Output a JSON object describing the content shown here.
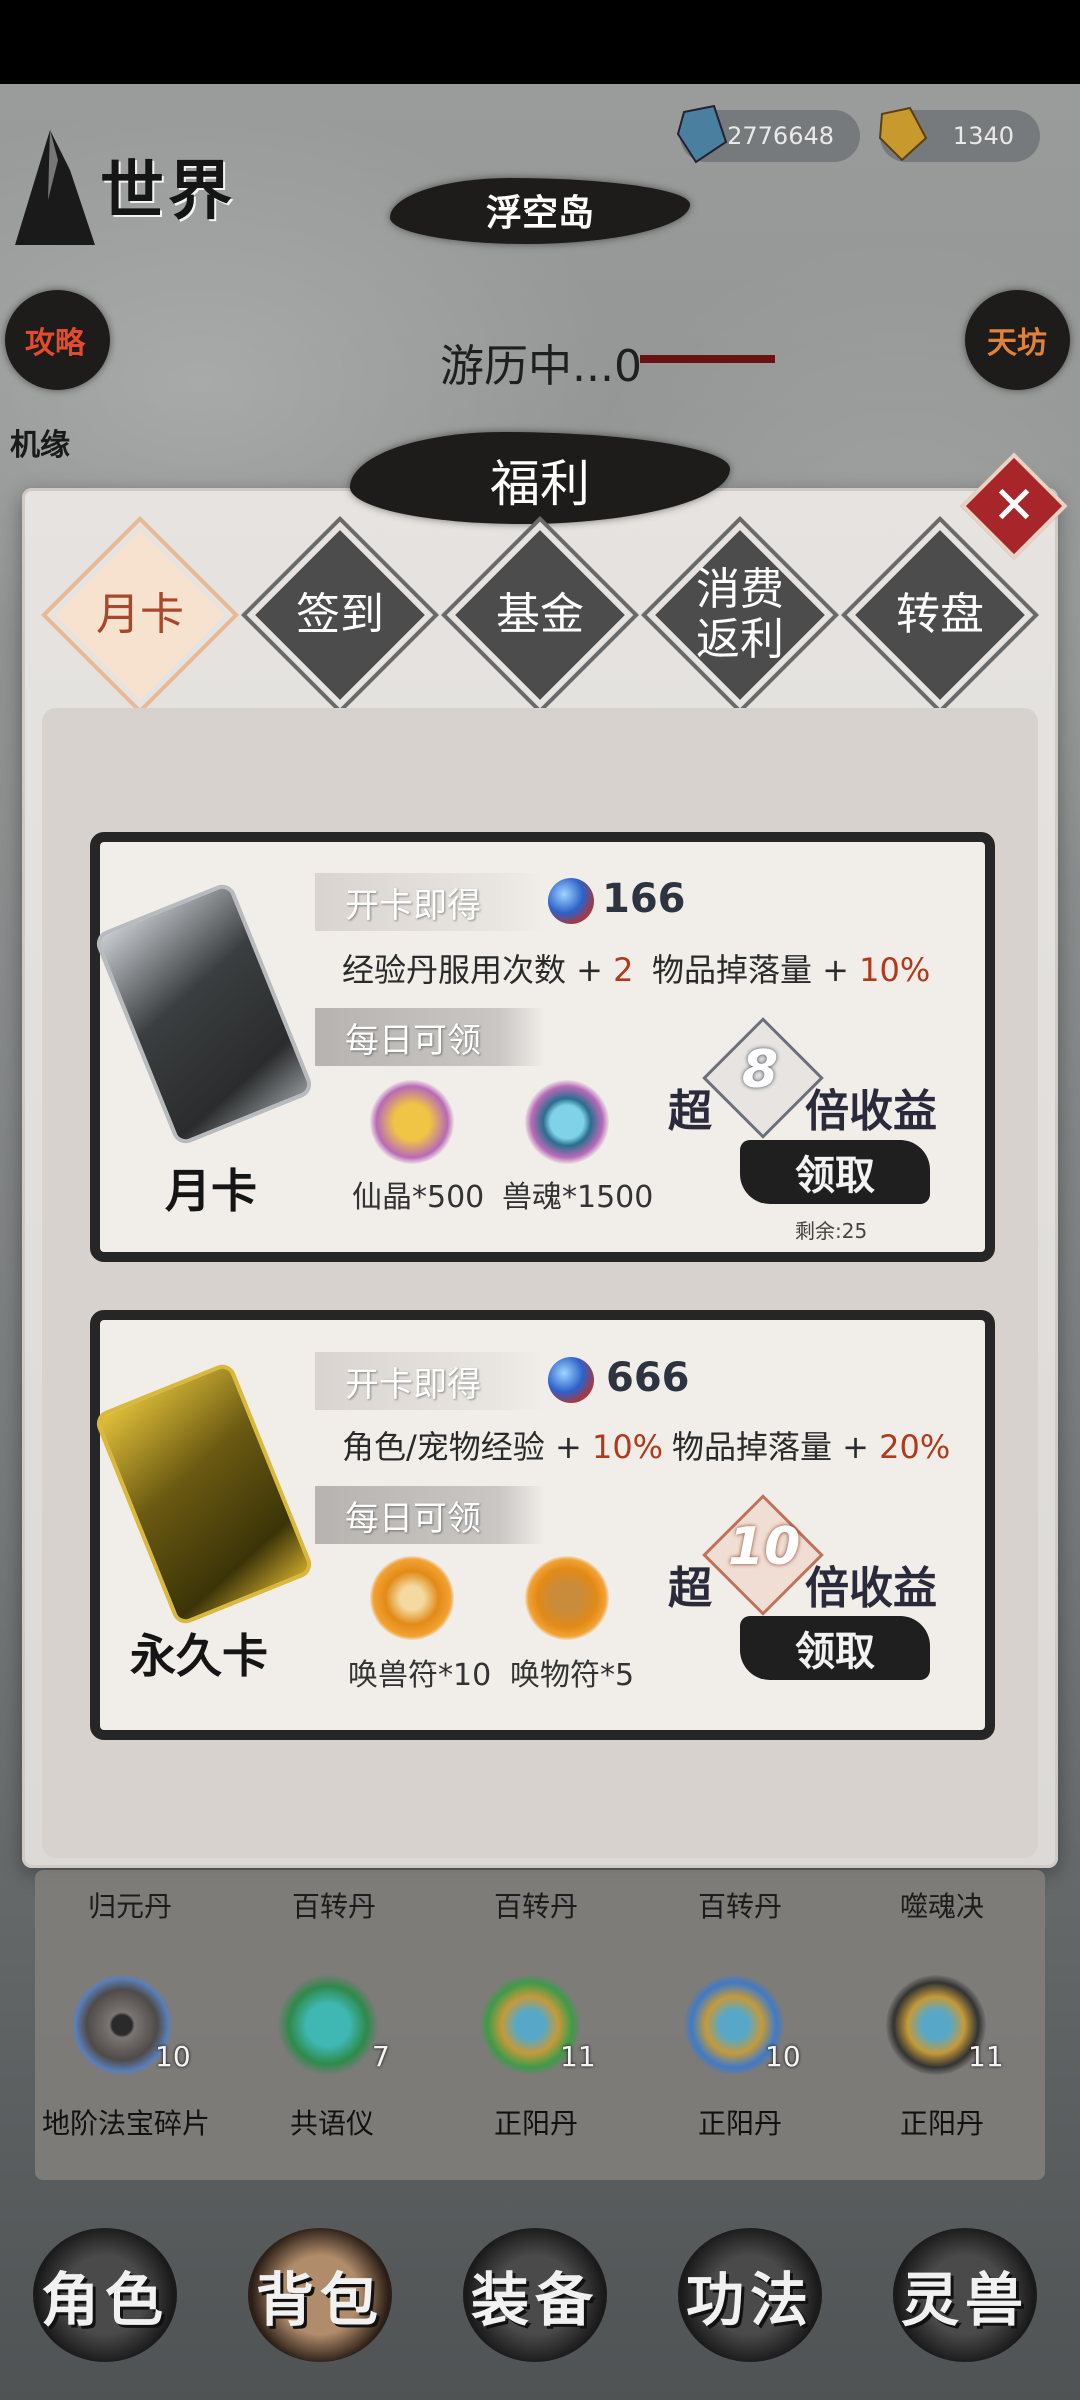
{
  "world": {
    "title": "世界",
    "location": "浮空岛",
    "travel_status": "游历中...0"
  },
  "currencies": [
    {
      "name": "spirit-crystal",
      "value": "2776648",
      "color": "#4a7fa0"
    },
    {
      "name": "gold-ingot",
      "value": "1340",
      "color": "#c89a2e"
    }
  ],
  "side_buttons": {
    "guide": "攻略",
    "chance": "机缘",
    "market": "天坊"
  },
  "panel": {
    "title": "福利",
    "tabs": [
      {
        "label": "月卡",
        "active": true
      },
      {
        "label": "签到",
        "active": false
      },
      {
        "label": "基金",
        "active": false
      },
      {
        "label": "消费\n返利",
        "active": false
      },
      {
        "label": "转盘",
        "active": false
      }
    ]
  },
  "cards": [
    {
      "name": "月卡",
      "instant_label": "开卡即得",
      "instant_amount": "166",
      "stats": [
        {
          "text": "经验丹服用次数 + ",
          "value": "2"
        },
        {
          "text": "物品掉落量 + ",
          "value": "10%"
        }
      ],
      "daily_label": "每日可领",
      "daily_items": [
        {
          "label": "仙晶*500",
          "icon": "gold-crystal-icon"
        },
        {
          "label": "兽魂*1500",
          "icon": "beast-soul-icon"
        }
      ],
      "multiplier_prefix": "超",
      "multiplier": "8",
      "multiplier_suffix": "倍收益",
      "claim_label": "领取",
      "remaining": "剩余:25"
    },
    {
      "name": "永久卡",
      "instant_label": "开卡即得",
      "instant_amount": "666",
      "stats": [
        {
          "text": "角色/宠物经验 + ",
          "value": "10%"
        },
        {
          "text": "物品掉落量 + ",
          "value": "20%"
        }
      ],
      "daily_label": "每日可领",
      "daily_items": [
        {
          "label": "唤兽符*10",
          "icon": "beast-talisman-icon"
        },
        {
          "label": "唤物符*5",
          "icon": "item-talisman-icon"
        }
      ],
      "multiplier_prefix": "超",
      "multiplier": "10",
      "multiplier_suffix": "倍收益",
      "claim_label": "领取"
    }
  ],
  "inventory": {
    "top_row": [
      "归元丹",
      "百转丹",
      "百转丹",
      "百转丹",
      "噬魂决"
    ],
    "items": [
      {
        "name": "地阶法宝碎片",
        "count": "10"
      },
      {
        "name": "共语仪",
        "count": "7"
      },
      {
        "name": "正阳丹",
        "count": "11"
      },
      {
        "name": "正阳丹",
        "count": "10"
      },
      {
        "name": "正阳丹",
        "count": "11"
      }
    ]
  },
  "bottom_nav": [
    "角色",
    "背包",
    "装备",
    "功法",
    "灵兽"
  ]
}
